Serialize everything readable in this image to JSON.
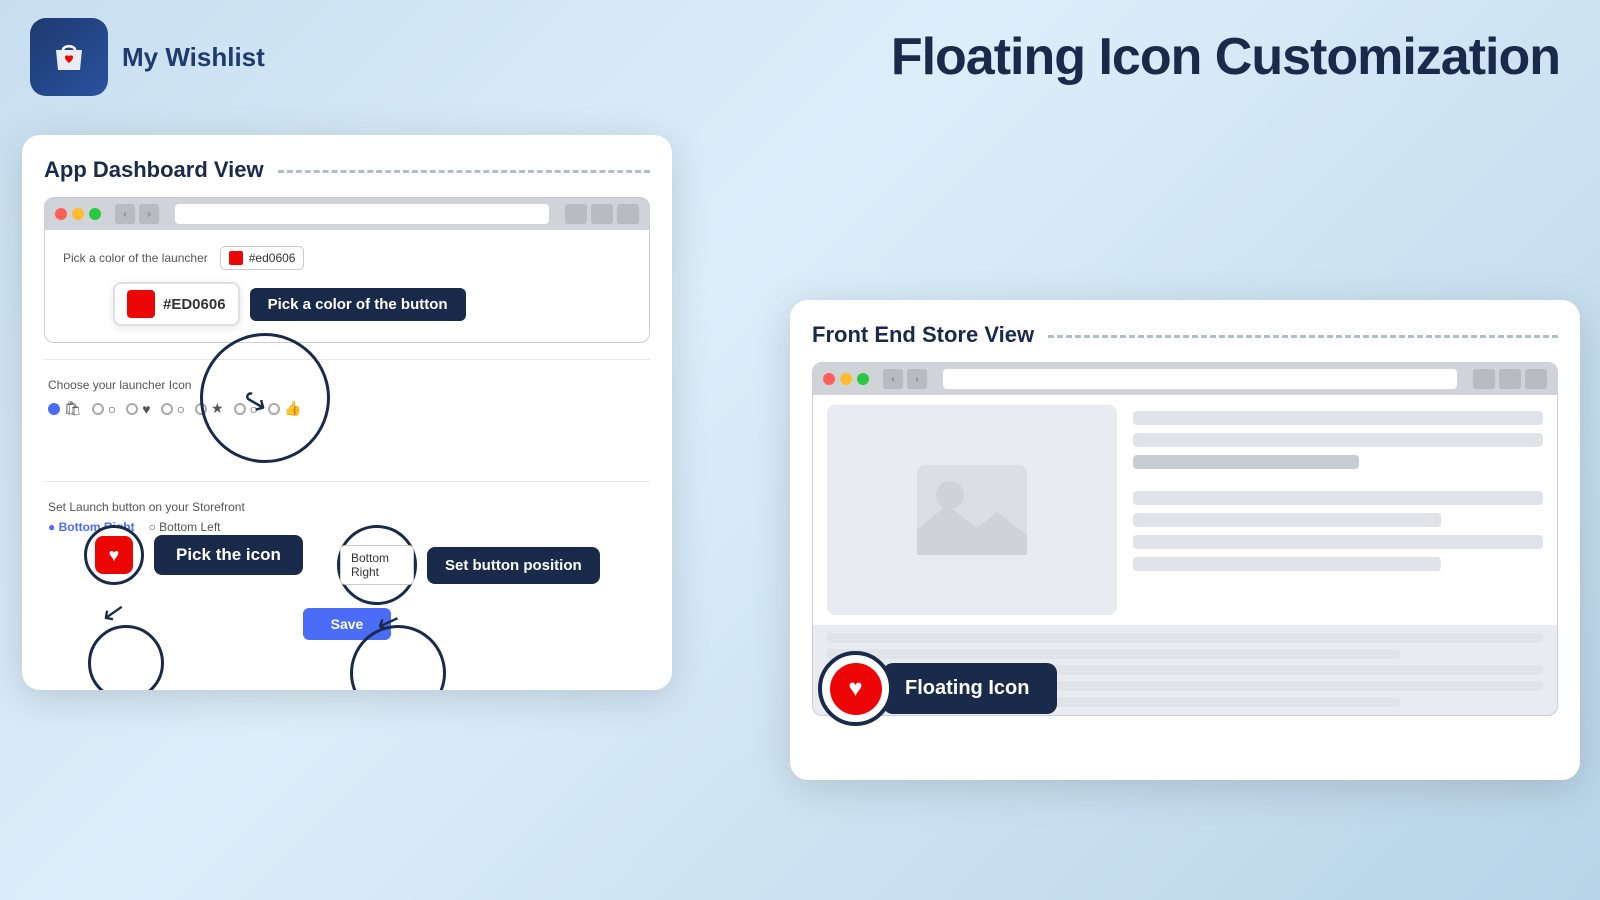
{
  "header": {
    "app_name": "My Wishlist",
    "page_title": "Floating Icon Customization"
  },
  "dashboard_panel": {
    "title": "App Dashboard View",
    "browser": {
      "url_placeholder": ""
    },
    "color_section": {
      "label": "Pick a color of the launcher",
      "color_value": "#ed0606",
      "callout_color_value": "#ED0606",
      "callout_label": "Pick a color of the button"
    },
    "icon_section": {
      "label": "Choose your launcher Icon",
      "pick_icon_label": "Pick the icon"
    },
    "position_section": {
      "label": "Set Launch button on your Storefront",
      "options": [
        "Bottom Right",
        "Bottom Left"
      ],
      "selected": "Bottom Right",
      "input_value": "Bottom Right",
      "callout_label": "Set button position"
    },
    "save_button": "Save"
  },
  "frontend_panel": {
    "title": "Front End Store View",
    "floating_icon": {
      "label": "Floating Icon"
    }
  },
  "icons": {
    "bag": "🛍",
    "heart_unicode": "♥",
    "star_unicode": "★",
    "thumbs_up": "👍",
    "circle": "○",
    "shopping_bag": "🛒"
  }
}
